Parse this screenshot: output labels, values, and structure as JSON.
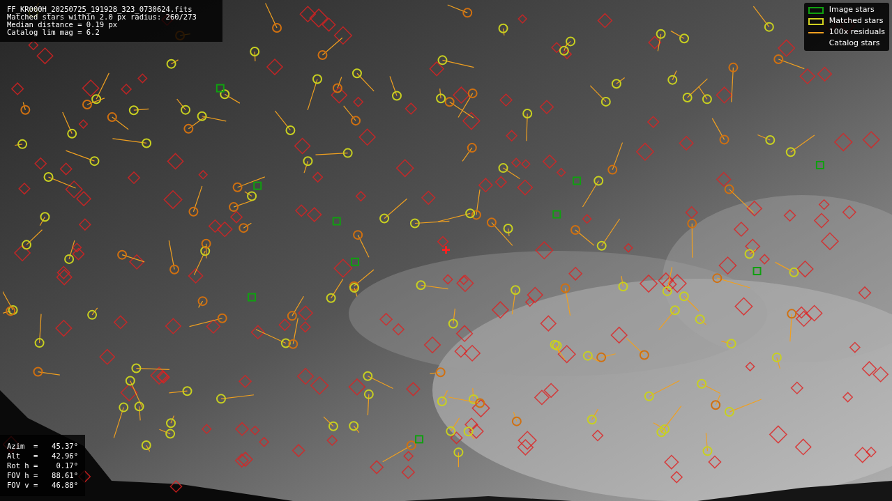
{
  "info": {
    "lines": [
      "FF_KR000H_20250725_191928_323_0730624.fits",
      "Matched stars within 2.0 px radius: 260/273",
      "Median distance = 0.19 px",
      "Catalog lim mag = 6.2"
    ]
  },
  "legend": [
    {
      "label": "Image stars"
    },
    {
      "kind": "matched",
      "label": "Matched stars"
    },
    {
      "kind": "residual",
      "label": "100x residuals"
    },
    {
      "kind": "catalog",
      "label": "Catalog stars"
    }
  ],
  "pointing": [
    {
      "label": "Azim  =",
      "value": "45.37°"
    },
    {
      "label": "Alt   =",
      "value": "42.96°"
    },
    {
      "label": "Rot h =",
      "value": " 0.17°"
    },
    {
      "label": "FOV h =",
      "value": "88.61°"
    },
    {
      "label": "FOV v =",
      "value": "46.88°"
    }
  ]
}
